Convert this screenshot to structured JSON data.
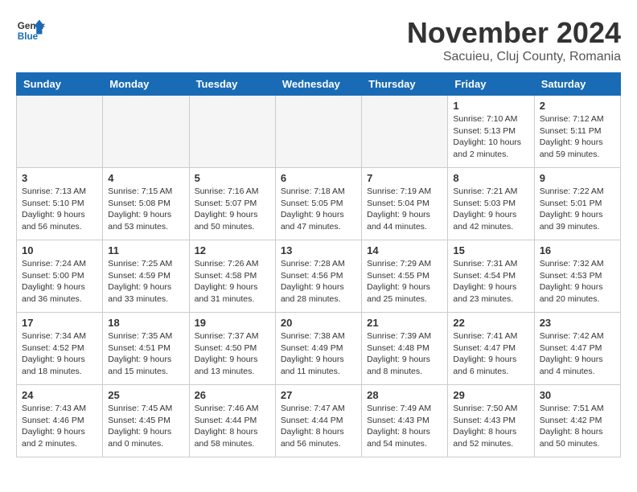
{
  "logo": {
    "line1": "General",
    "line2": "Blue"
  },
  "title": "November 2024",
  "subtitle": "Sacuieu, Cluj County, Romania",
  "days_of_week": [
    "Sunday",
    "Monday",
    "Tuesday",
    "Wednesday",
    "Thursday",
    "Friday",
    "Saturday"
  ],
  "weeks": [
    [
      {
        "day": "",
        "empty": true
      },
      {
        "day": "",
        "empty": true
      },
      {
        "day": "",
        "empty": true
      },
      {
        "day": "",
        "empty": true
      },
      {
        "day": "",
        "empty": true
      },
      {
        "day": "1",
        "info": "Sunrise: 7:10 AM\nSunset: 5:13 PM\nDaylight: 10 hours\nand 2 minutes."
      },
      {
        "day": "2",
        "info": "Sunrise: 7:12 AM\nSunset: 5:11 PM\nDaylight: 9 hours\nand 59 minutes."
      }
    ],
    [
      {
        "day": "3",
        "info": "Sunrise: 7:13 AM\nSunset: 5:10 PM\nDaylight: 9 hours\nand 56 minutes."
      },
      {
        "day": "4",
        "info": "Sunrise: 7:15 AM\nSunset: 5:08 PM\nDaylight: 9 hours\nand 53 minutes."
      },
      {
        "day": "5",
        "info": "Sunrise: 7:16 AM\nSunset: 5:07 PM\nDaylight: 9 hours\nand 50 minutes."
      },
      {
        "day": "6",
        "info": "Sunrise: 7:18 AM\nSunset: 5:05 PM\nDaylight: 9 hours\nand 47 minutes."
      },
      {
        "day": "7",
        "info": "Sunrise: 7:19 AM\nSunset: 5:04 PM\nDaylight: 9 hours\nand 44 minutes."
      },
      {
        "day": "8",
        "info": "Sunrise: 7:21 AM\nSunset: 5:03 PM\nDaylight: 9 hours\nand 42 minutes."
      },
      {
        "day": "9",
        "info": "Sunrise: 7:22 AM\nSunset: 5:01 PM\nDaylight: 9 hours\nand 39 minutes."
      }
    ],
    [
      {
        "day": "10",
        "info": "Sunrise: 7:24 AM\nSunset: 5:00 PM\nDaylight: 9 hours\nand 36 minutes."
      },
      {
        "day": "11",
        "info": "Sunrise: 7:25 AM\nSunset: 4:59 PM\nDaylight: 9 hours\nand 33 minutes."
      },
      {
        "day": "12",
        "info": "Sunrise: 7:26 AM\nSunset: 4:58 PM\nDaylight: 9 hours\nand 31 minutes."
      },
      {
        "day": "13",
        "info": "Sunrise: 7:28 AM\nSunset: 4:56 PM\nDaylight: 9 hours\nand 28 minutes."
      },
      {
        "day": "14",
        "info": "Sunrise: 7:29 AM\nSunset: 4:55 PM\nDaylight: 9 hours\nand 25 minutes."
      },
      {
        "day": "15",
        "info": "Sunrise: 7:31 AM\nSunset: 4:54 PM\nDaylight: 9 hours\nand 23 minutes."
      },
      {
        "day": "16",
        "info": "Sunrise: 7:32 AM\nSunset: 4:53 PM\nDaylight: 9 hours\nand 20 minutes."
      }
    ],
    [
      {
        "day": "17",
        "info": "Sunrise: 7:34 AM\nSunset: 4:52 PM\nDaylight: 9 hours\nand 18 minutes."
      },
      {
        "day": "18",
        "info": "Sunrise: 7:35 AM\nSunset: 4:51 PM\nDaylight: 9 hours\nand 15 minutes."
      },
      {
        "day": "19",
        "info": "Sunrise: 7:37 AM\nSunset: 4:50 PM\nDaylight: 9 hours\nand 13 minutes."
      },
      {
        "day": "20",
        "info": "Sunrise: 7:38 AM\nSunset: 4:49 PM\nDaylight: 9 hours\nand 11 minutes."
      },
      {
        "day": "21",
        "info": "Sunrise: 7:39 AM\nSunset: 4:48 PM\nDaylight: 9 hours\nand 8 minutes."
      },
      {
        "day": "22",
        "info": "Sunrise: 7:41 AM\nSunset: 4:47 PM\nDaylight: 9 hours\nand 6 minutes."
      },
      {
        "day": "23",
        "info": "Sunrise: 7:42 AM\nSunset: 4:47 PM\nDaylight: 9 hours\nand 4 minutes."
      }
    ],
    [
      {
        "day": "24",
        "info": "Sunrise: 7:43 AM\nSunset: 4:46 PM\nDaylight: 9 hours\nand 2 minutes."
      },
      {
        "day": "25",
        "info": "Sunrise: 7:45 AM\nSunset: 4:45 PM\nDaylight: 9 hours\nand 0 minutes."
      },
      {
        "day": "26",
        "info": "Sunrise: 7:46 AM\nSunset: 4:44 PM\nDaylight: 8 hours\nand 58 minutes."
      },
      {
        "day": "27",
        "info": "Sunrise: 7:47 AM\nSunset: 4:44 PM\nDaylight: 8 hours\nand 56 minutes."
      },
      {
        "day": "28",
        "info": "Sunrise: 7:49 AM\nSunset: 4:43 PM\nDaylight: 8 hours\nand 54 minutes."
      },
      {
        "day": "29",
        "info": "Sunrise: 7:50 AM\nSunset: 4:43 PM\nDaylight: 8 hours\nand 52 minutes."
      },
      {
        "day": "30",
        "info": "Sunrise: 7:51 AM\nSunset: 4:42 PM\nDaylight: 8 hours\nand 50 minutes."
      }
    ]
  ]
}
